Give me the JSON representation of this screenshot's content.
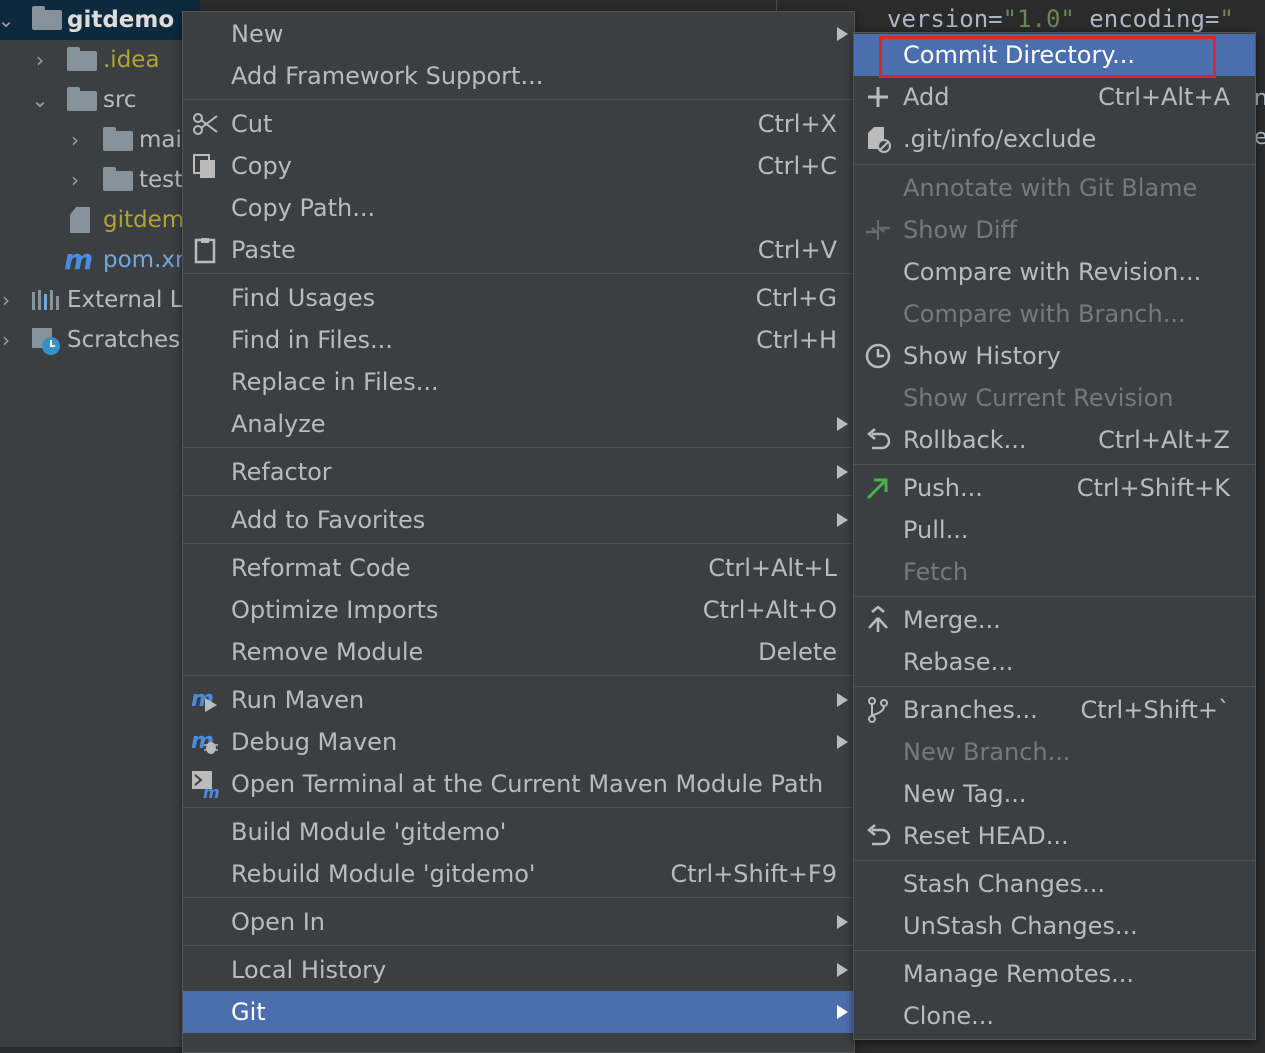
{
  "project_tree": {
    "root": "gitdemo",
    "items": [
      {
        "label": ".idea"
      },
      {
        "label": "src"
      },
      {
        "label": "mai"
      },
      {
        "label": "test"
      },
      {
        "label": "gitdem"
      },
      {
        "label": "pom.xr"
      },
      {
        "label": "External Li"
      },
      {
        "label": "Scratches"
      }
    ]
  },
  "editor": {
    "code_prefix": "version=",
    "version_value": "\"1.0\"",
    "code_mid": " encoding=",
    "code_tail": "\"",
    "edge_chars": [
      "n",
      "e"
    ]
  },
  "context_menu": {
    "items": [
      {
        "label": "New"
      },
      {
        "label": "Add Framework Support..."
      },
      {
        "label": "Cut",
        "shortcut": "Ctrl+X"
      },
      {
        "label": "Copy",
        "shortcut": "Ctrl+C"
      },
      {
        "label": "Copy Path..."
      },
      {
        "label": "Paste",
        "shortcut": "Ctrl+V"
      },
      {
        "label": "Find Usages",
        "shortcut": "Ctrl+G"
      },
      {
        "label": "Find in Files...",
        "shortcut": "Ctrl+H"
      },
      {
        "label": "Replace in Files..."
      },
      {
        "label": "Analyze"
      },
      {
        "label": "Refactor"
      },
      {
        "label": "Add to Favorites"
      },
      {
        "label": "Reformat Code",
        "shortcut": "Ctrl+Alt+L"
      },
      {
        "label": "Optimize Imports",
        "shortcut": "Ctrl+Alt+O"
      },
      {
        "label": "Remove Module",
        "shortcut": "Delete"
      },
      {
        "label": "Run Maven"
      },
      {
        "label": "Debug Maven"
      },
      {
        "label": "Open Terminal at the Current Maven Module Path"
      },
      {
        "label": "Build Module 'gitdemo'"
      },
      {
        "label": "Rebuild Module 'gitdemo'",
        "shortcut": "Ctrl+Shift+F9"
      },
      {
        "label": "Open In"
      },
      {
        "label": "Local History"
      },
      {
        "label": "Git"
      }
    ]
  },
  "git_menu": {
    "items": [
      {
        "label": "Commit Directory..."
      },
      {
        "label": "Add",
        "shortcut": "Ctrl+Alt+A"
      },
      {
        "label": ".git/info/exclude"
      },
      {
        "label": "Annotate with Git Blame"
      },
      {
        "label": "Show Diff"
      },
      {
        "label": "Compare with Revision..."
      },
      {
        "label": "Compare with Branch..."
      },
      {
        "label": "Show History"
      },
      {
        "label": "Show Current Revision"
      },
      {
        "label": "Rollback...",
        "shortcut": "Ctrl+Alt+Z"
      },
      {
        "label": "Push...",
        "shortcut": "Ctrl+Shift+K"
      },
      {
        "label": "Pull..."
      },
      {
        "label": "Fetch"
      },
      {
        "label": "Merge..."
      },
      {
        "label": "Rebase..."
      },
      {
        "label": "Branches...",
        "shortcut": "Ctrl+Shift+`"
      },
      {
        "label": "New Branch..."
      },
      {
        "label": "New Tag..."
      },
      {
        "label": "Reset HEAD..."
      },
      {
        "label": "Stash Changes..."
      },
      {
        "label": "UnStash Changes..."
      },
      {
        "label": "Manage Remotes..."
      },
      {
        "label": "Clone..."
      }
    ]
  },
  "colors": {
    "menu_bg": "#3c3f41",
    "selection": "#4b6eaf",
    "highlight_box": "#e0242b",
    "disabled_text": "#787878",
    "push_arrow": "#4caf50"
  }
}
